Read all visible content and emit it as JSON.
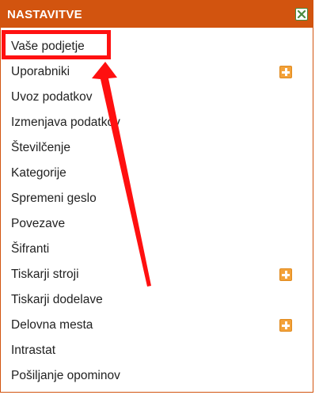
{
  "header": {
    "title": "NASTAVITVE",
    "close_icon": "close-icon",
    "header_color": "#d2540f"
  },
  "menu": {
    "items": [
      {
        "label": "Vaše podjetje",
        "has_add": false
      },
      {
        "label": "Uporabniki",
        "has_add": true
      },
      {
        "label": "Uvoz podatkov",
        "has_add": false
      },
      {
        "label": "Izmenjava podatkov",
        "has_add": false
      },
      {
        "label": "Številčenje",
        "has_add": false
      },
      {
        "label": "Kategorije",
        "has_add": false
      },
      {
        "label": "Spremeni geslo",
        "has_add": false
      },
      {
        "label": "Povezave",
        "has_add": false
      },
      {
        "label": "Šifranti",
        "has_add": false
      },
      {
        "label": "Tiskarji stroji",
        "has_add": true
      },
      {
        "label": "Tiskarji dodelave",
        "has_add": false
      },
      {
        "label": "Delovna mesta",
        "has_add": true
      },
      {
        "label": "Intrastat",
        "has_add": false
      },
      {
        "label": "Pošiljanje opominov",
        "has_add": false
      }
    ],
    "add_icon": "plus-icon",
    "add_icon_color": "#f3a23a"
  },
  "annotation": {
    "highlight_color": "#ff1010",
    "highlighted_item": "Vaše podjetje",
    "arrow_color": "#ff1010"
  }
}
